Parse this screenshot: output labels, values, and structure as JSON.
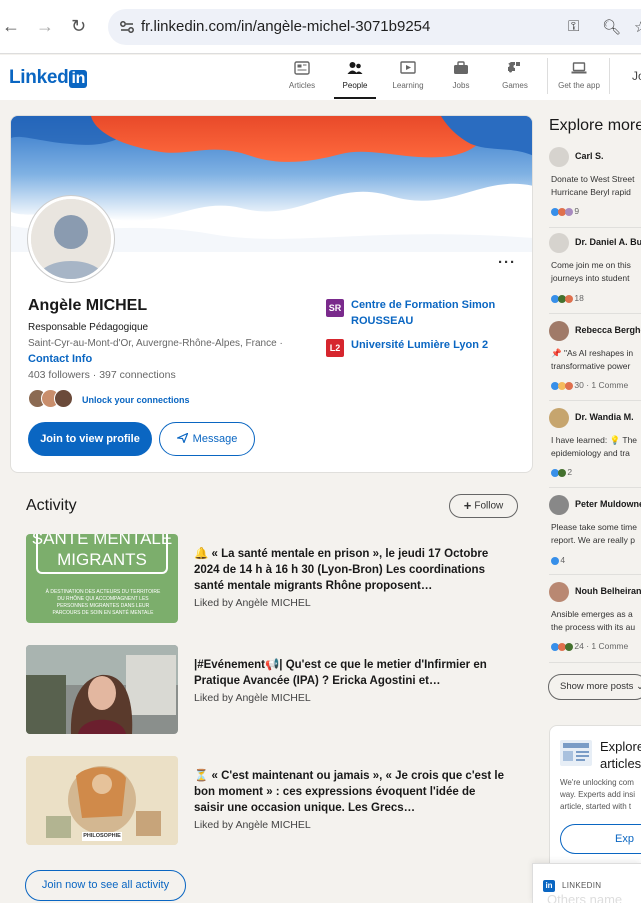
{
  "browser": {
    "url": "fr.linkedin.com/in/angèle-michel-3071b9254"
  },
  "header": {
    "logo_text": "Linked",
    "logo_in": "in",
    "nav": [
      {
        "label": "Articles",
        "icon": "articles-icon"
      },
      {
        "label": "People",
        "icon": "people-icon",
        "active": true
      },
      {
        "label": "Learning",
        "icon": "learning-icon"
      },
      {
        "label": "Jobs",
        "icon": "jobs-icon"
      },
      {
        "label": "Games",
        "icon": "games-icon"
      },
      {
        "label": "Get the app",
        "icon": "laptop-icon"
      }
    ],
    "join_text": "Jo"
  },
  "profile": {
    "name": "Angèle MICHEL",
    "headline": "Responsable Pédagogique",
    "location": "Saint-Cyr-au-Mont-d'Or, Auvergne-Rhône-Alpes, France",
    "location_sep": "·",
    "contact_info": "Contact Info",
    "followers": "403 followers",
    "stats_sep": "·",
    "connections": "397 connections",
    "unlock": "Unlock your connections",
    "join_button": "Join to view profile",
    "message_button": "Message",
    "more": "···",
    "orgs": [
      {
        "name": "Centre de Formation Simon ROUSSEAU",
        "logo": "SR",
        "color": "#7a2a8c"
      },
      {
        "name": "Université Lumière Lyon 2",
        "logo": "L2",
        "color": "#d6262e"
      }
    ]
  },
  "activity": {
    "title": "Activity",
    "follow_button": "Follow",
    "items": [
      {
        "thumb_lines": [
          "SANTÉ MENTALE",
          "MIGRANTS"
        ],
        "thumb_small": "À DESTINATION DES ACTEURS DU TERRITOIRE DU RHÔNE QUI ACCOMPAGNENT LES PERSONNES MIGRANTES DANS LEUR PARCOURS DE SOIN EN SANTÉ MENTALE",
        "text": "🔔 « La santé mentale en prison », le jeudi 17 Octobre 2024 de 14 h à 16 h 30 (Lyon-Bron) Les coordinations santé mentale migrants Rhône proposent…",
        "liked": "Liked by Angèle MICHEL"
      },
      {
        "text": "|#Evénement📢| Qu'est ce que le metier d'Infirmier en Pratique Avancée (IPA) ? Ericka Agostini et…",
        "liked": "Liked by Angèle MICHEL"
      },
      {
        "thumb_label": "PHILOSOPHIE",
        "text": "⏳ « C'est maintenant ou jamais », « Je crois que c'est le bon moment » : ces expressions évoquent l'idée de saisir une occasion unique. Les Grecs…",
        "liked": "Liked by Angèle MICHEL"
      }
    ],
    "join_all": "Join now to see all activity"
  },
  "rail": {
    "title": "Explore more",
    "items": [
      {
        "name": "Carl S.",
        "lines": [
          "Donate to West Street",
          "Hurricane Beryl rapid"
        ],
        "reactions": "9"
      },
      {
        "name": "Dr. Daniel A. Bu",
        "lines": [
          "Come join me on this",
          "journeys into student"
        ],
        "reactions": "18"
      },
      {
        "name": "Rebecca Bergho",
        "lines": [
          "📌 \"As AI reshapes in",
          "transformative power"
        ],
        "reactions": "30 · 1 Comme"
      },
      {
        "name": "Dr. Wandia M.",
        "lines": [
          "I have learned: 💡 The",
          "epidemiology and tra"
        ],
        "reactions": "2"
      },
      {
        "name": "Peter Muldowne",
        "lines": [
          "Please take some time",
          "report. We are really p"
        ],
        "reactions": "4"
      },
      {
        "name": "Nouh Belheiran",
        "lines": [
          "Ansible emerges as a",
          "the process with its au"
        ],
        "reactions": "24 · 1 Comme"
      }
    ],
    "show_more": "Show more posts",
    "articles_title": "Explore articles",
    "articles_text": [
      "We're unlocking com",
      "way. Experts add insi",
      "article, started with t"
    ],
    "articles_button": "Exp",
    "popup_brand": "LINKEDIN",
    "popup_text": "Others name"
  },
  "colors": {
    "brand": "#0a66c2"
  }
}
